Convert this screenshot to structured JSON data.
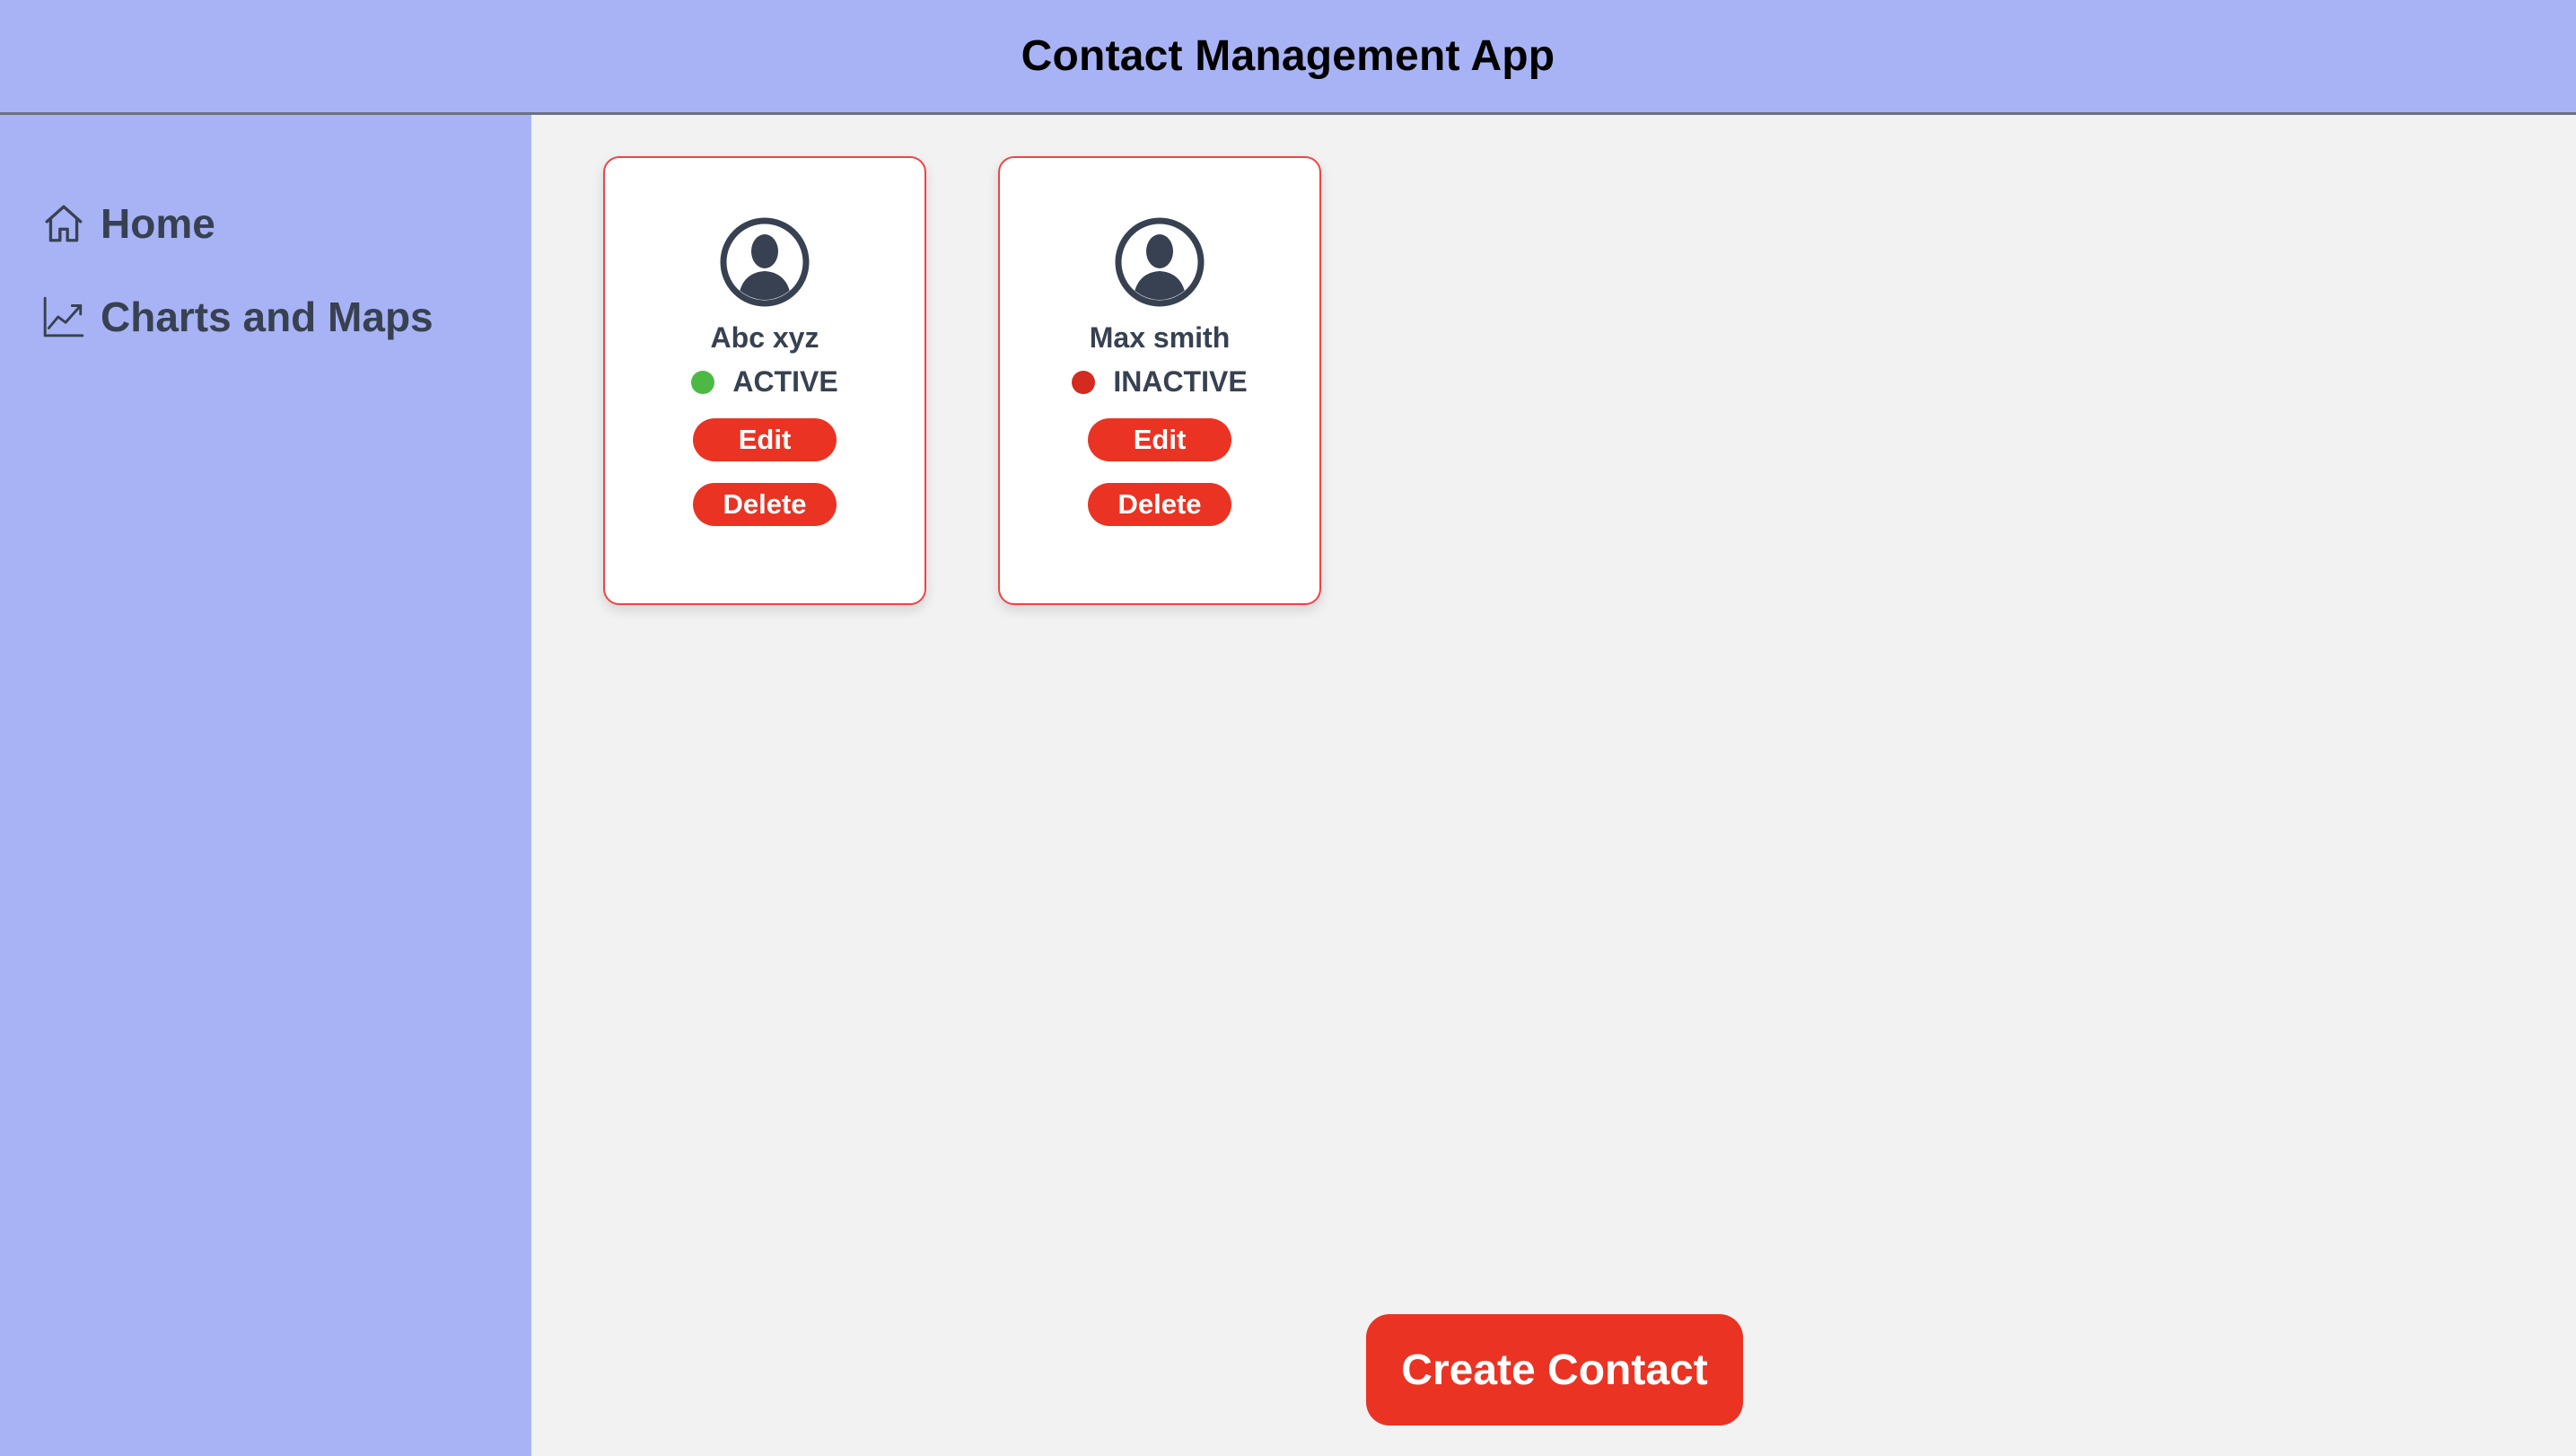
{
  "header": {
    "title": "Contact Management App"
  },
  "sidebar": {
    "items": [
      {
        "label": "Home",
        "icon": "home-icon"
      },
      {
        "label": "Charts and Maps",
        "icon": "chart-line-icon"
      }
    ]
  },
  "contacts": [
    {
      "name": "Abc xyz",
      "status": "ACTIVE",
      "status_color": "#4cb944",
      "edit_label": "Edit",
      "delete_label": "Delete"
    },
    {
      "name": "Max smith",
      "status": "INACTIVE",
      "status_color": "#d42a1f",
      "edit_label": "Edit",
      "delete_label": "Delete"
    }
  ],
  "actions": {
    "create_label": "Create Contact"
  },
  "colors": {
    "header_bg": "#a8b3f6",
    "sidebar_bg": "#a8b3f6",
    "accent": "#ea3323",
    "main_bg": "#f2f2f2",
    "text": "#374151"
  }
}
